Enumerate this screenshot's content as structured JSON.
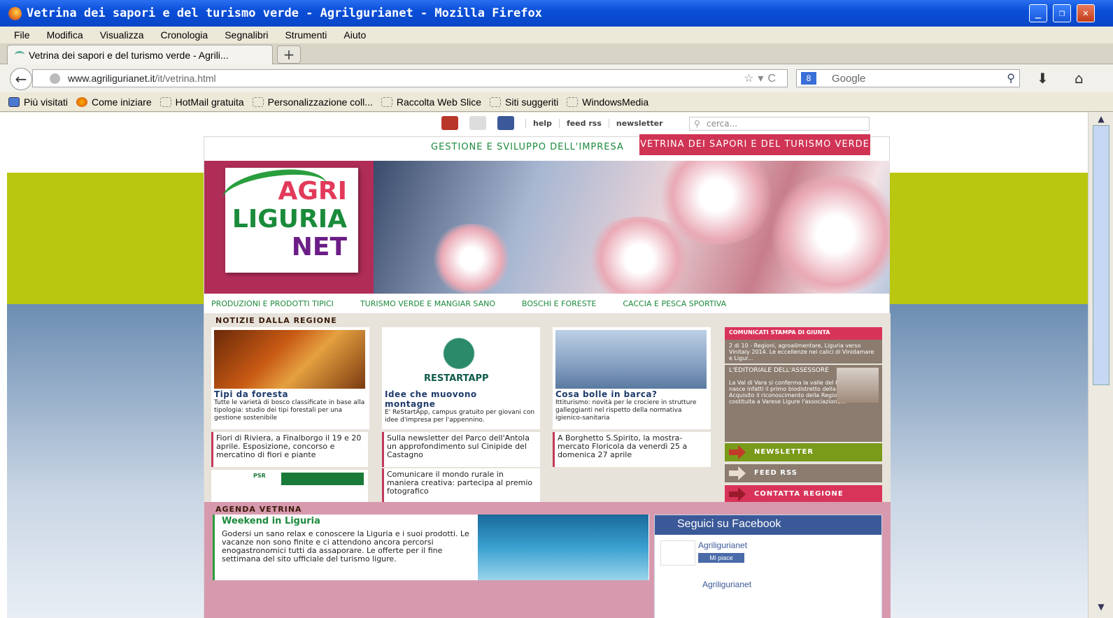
{
  "window": {
    "title": "Vetrina dei sapori e del turismo verde - Agrilgurianet - Mozilla Firefox"
  },
  "menu": [
    "File",
    "Modifica",
    "Visualizza",
    "Cronologia",
    "Segnalibri",
    "Strumenti",
    "Aiuto"
  ],
  "tab": {
    "label": "Vetrina dei sapori e del turismo verde - Agrili..."
  },
  "url": {
    "host": "www.agriligurianet.it",
    "path": "/it/vetrina.html"
  },
  "search": {
    "placeholder": "Google"
  },
  "bookmarks": [
    "Più visitati",
    "Come iniziare",
    "HotMail gratuita",
    "Personalizzazione coll...",
    "Raccolta Web Slice",
    "Siti suggeriti",
    "WindowsMedia"
  ],
  "site": {
    "toplinks": [
      "help",
      "feed rss",
      "newsletter"
    ],
    "search_placeholder": "cerca...",
    "nav": [
      "GESTIONE E SVILUPPO DELL'IMPRESA",
      "VETRINA DEI SAPORI E DEL TURISMO VERDE"
    ],
    "logo": [
      "AGRI",
      "LIGURIA",
      "NET"
    ],
    "categories": [
      "PRODUZIONI E PRODOTTI TIPICI",
      "TURISMO VERDE E MANGIAR SANO",
      "BOSCHI E FORESTE",
      "CACCIA E PESCA SPORTIVA"
    ],
    "news_heading": "NOTIZIE DALLA REGIONE",
    "cards": [
      {
        "title": "Tipi da foresta",
        "text": "Tutte le varietà di bosco classificate in base alla tipologia: studio dei tipi forestali per una gestione sostenibile"
      },
      {
        "title": "Idee che muovono montagne",
        "text": "E' ReStartApp, campus gratuito per giovani con idee d'impresa per l'appennino.",
        "logo": "RESTARTAPP"
      },
      {
        "title": "Cosa bolle in barca?",
        "text": "Ittiturismo: novità per le crociere in strutture galleggianti nel rispetto della normativa igienico-sanitaria"
      }
    ],
    "news": [
      "Fiori di Riviera, a Finalborgo il 19 e 20 aprile. Esposizione, concorso e mercatino di fiori e piante",
      "Sulla newsletter del Parco dell'Antola un approfondimento sul Cinipide del Castagno",
      "A Borghetto S.Spirito, la mostra-mercato Floricola da venerdì 25 a domenica 27 aprile",
      "Comunicare il mondo rurale in maniera creativa: partecipa al premio fotografico"
    ],
    "psr": "PSR",
    "sidebar": {
      "comunicati_head": "COMUNICATI STAMPA DI GIUNTA",
      "comunicati_text": "2 di 10 - Regioni, agroalimentare, Liguria verso Vinitaly 2014. Le eccellenze nei calici di Vinidamare e Ligur...",
      "editoriale_head": "L'EDITORIALE DELL'ASSESSORE",
      "editoriale_text": "La Val di Vara si conferma la valle del biologico: qui nasce infatti il primo biodistretto della Liguria. Acquisito il riconoscimento della Regione, si è costituita a Varese Ligure l'associazione...",
      "buttons": [
        "NEWSLETTER",
        "FEED RSS",
        "CONTATTA REGIONE"
      ],
      "button_colors": [
        "#7a9a1a",
        "#8b7c6f",
        "#d8345a"
      ]
    },
    "agenda_heading": "AGENDA VETRINA",
    "agenda": {
      "title": "Weekend in Liguria",
      "text": "Godersi un sano relax e conoscere la Liguria e i suoi prodotti. Le vacanze non sono finite e ci attendono ancora percorsi enogastronomici tutti da assaporare. Le offerte per il fine settimana del sito ufficiale del turismo ligure."
    },
    "facebook": {
      "head": "Seguici su Facebook",
      "page": "Agriligurianet",
      "like": "Mi piace"
    }
  }
}
